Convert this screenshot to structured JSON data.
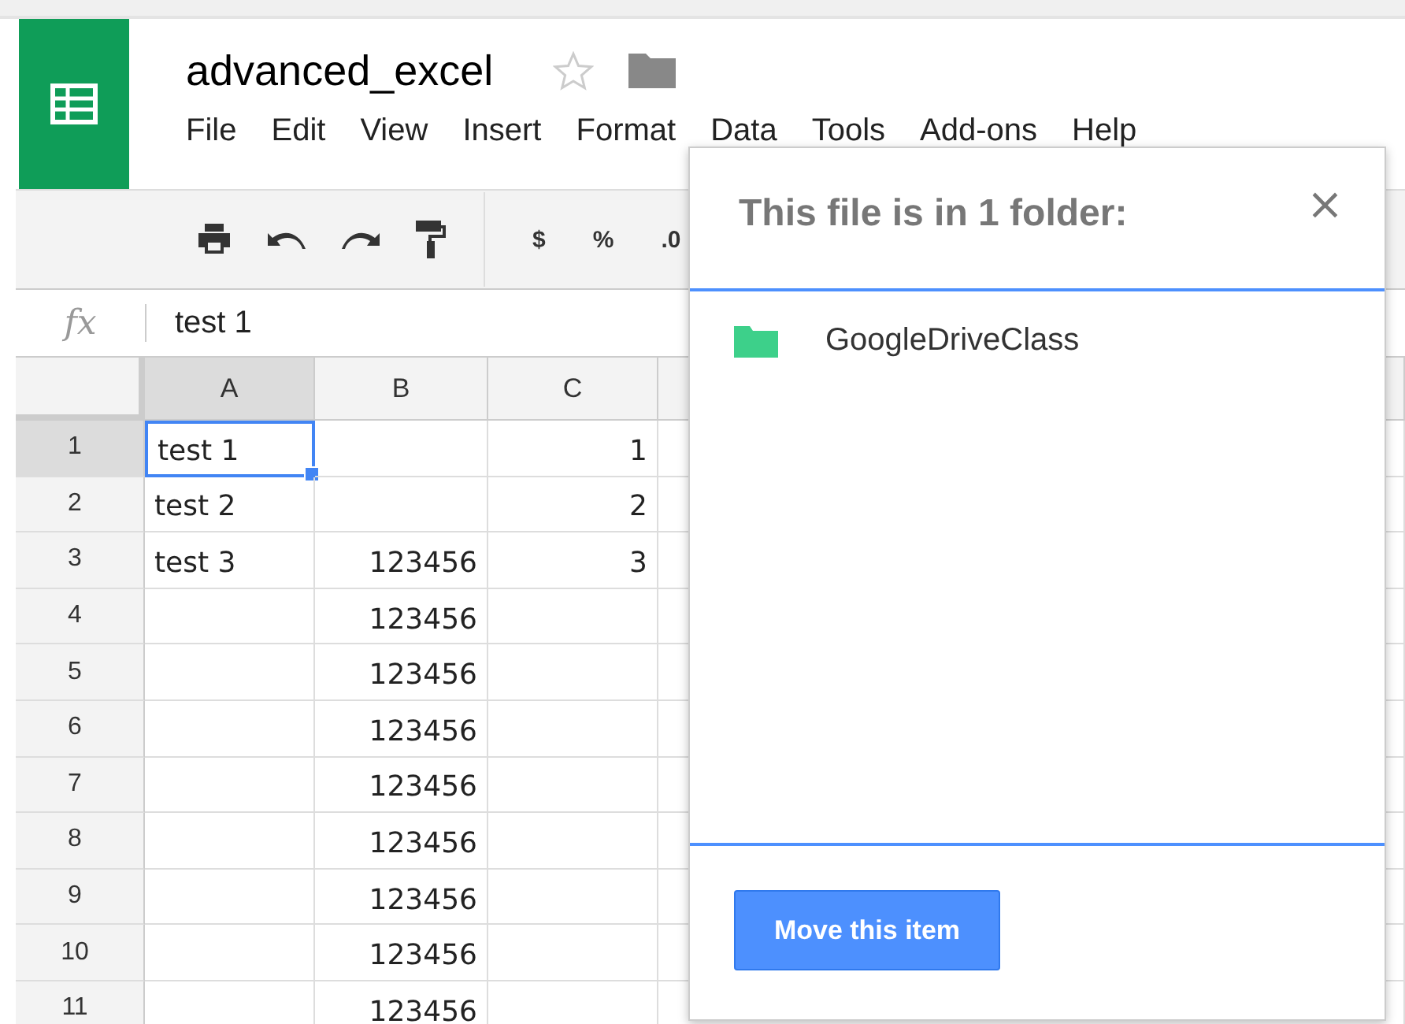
{
  "document": {
    "title": "advanced_excel",
    "starred": false
  },
  "menu": [
    {
      "label": "File"
    },
    {
      "label": "Edit"
    },
    {
      "label": "View"
    },
    {
      "label": "Insert"
    },
    {
      "label": "Format"
    },
    {
      "label": "Data"
    },
    {
      "label": "Tools"
    },
    {
      "label": "Add-ons"
    },
    {
      "label": "Help"
    }
  ],
  "toolbar": {
    "format_buttons": [
      "$",
      "%",
      ".0"
    ]
  },
  "formula_bar": {
    "label": "fx",
    "value": "test 1"
  },
  "sheet": {
    "columns": [
      {
        "label": "A",
        "selected": true
      },
      {
        "label": "B",
        "selected": false
      },
      {
        "label": "C",
        "selected": false
      }
    ],
    "rows": [
      {
        "label": "1",
        "selected": true,
        "cells": [
          {
            "kind": "text",
            "text": "test 1",
            "selected": true
          },
          {
            "kind": "number",
            "selected": false
          },
          {
            "kind": "number",
            "text": "1",
            "selected": false
          }
        ]
      },
      {
        "label": "2",
        "selected": false,
        "cells": [
          {
            "kind": "text",
            "text": "test 2",
            "selected": false
          },
          {
            "kind": "number",
            "selected": false
          },
          {
            "kind": "number",
            "text": "2",
            "selected": false
          }
        ]
      },
      {
        "label": "3",
        "selected": false,
        "cells": [
          {
            "kind": "text",
            "text": "test 3",
            "selected": false
          },
          {
            "kind": "number",
            "text": "123456",
            "selected": false
          },
          {
            "kind": "number",
            "text": "3",
            "selected": false
          }
        ]
      },
      {
        "label": "4",
        "selected": false,
        "cells": [
          {
            "kind": "text",
            "selected": false
          },
          {
            "kind": "number",
            "text": "123456",
            "selected": false
          },
          {
            "kind": "number",
            "selected": false
          }
        ]
      },
      {
        "label": "5",
        "selected": false,
        "cells": [
          {
            "kind": "text",
            "selected": false
          },
          {
            "kind": "number",
            "text": "123456",
            "selected": false
          },
          {
            "kind": "number",
            "selected": false
          }
        ]
      },
      {
        "label": "6",
        "selected": false,
        "cells": [
          {
            "kind": "text",
            "selected": false
          },
          {
            "kind": "number",
            "text": "123456",
            "selected": false
          },
          {
            "kind": "number",
            "selected": false
          }
        ]
      },
      {
        "label": "7",
        "selected": false,
        "cells": [
          {
            "kind": "text",
            "selected": false
          },
          {
            "kind": "number",
            "text": "123456",
            "selected": false
          },
          {
            "kind": "number",
            "selected": false
          }
        ]
      },
      {
        "label": "8",
        "selected": false,
        "cells": [
          {
            "kind": "text",
            "selected": false
          },
          {
            "kind": "number",
            "text": "123456",
            "selected": false
          },
          {
            "kind": "number",
            "selected": false
          }
        ]
      },
      {
        "label": "9",
        "selected": false,
        "cells": [
          {
            "kind": "text",
            "selected": false
          },
          {
            "kind": "number",
            "text": "123456",
            "selected": false
          },
          {
            "kind": "number",
            "selected": false
          }
        ]
      },
      {
        "label": "10",
        "selected": false,
        "cells": [
          {
            "kind": "text",
            "selected": false
          },
          {
            "kind": "number",
            "text": "123456",
            "selected": false
          },
          {
            "kind": "number",
            "selected": false
          }
        ]
      },
      {
        "label": "11",
        "selected": false,
        "cells": [
          {
            "kind": "text",
            "selected": false
          },
          {
            "kind": "number",
            "text": "123456",
            "selected": false
          },
          {
            "kind": "number",
            "selected": false
          }
        ]
      }
    ]
  },
  "folder_popup": {
    "title": "This file is in 1 folder:",
    "close": "×",
    "folders": [
      {
        "name": "GoogleDriveClass",
        "color": "#3dd08a"
      }
    ],
    "button": "Move this item"
  }
}
